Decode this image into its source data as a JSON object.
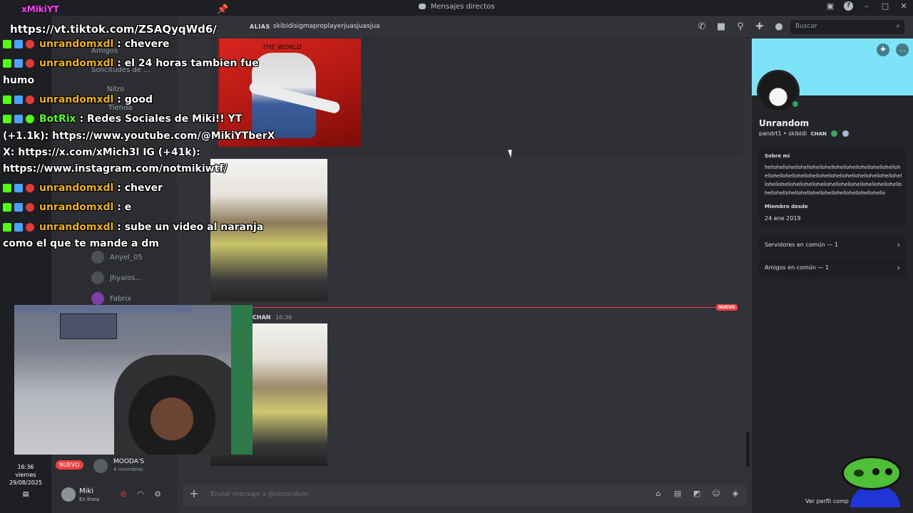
{
  "window": {
    "title": "Mensajes directos"
  },
  "header": {
    "alias_label": "ALIAS",
    "alias_value": "skibidisigmaproplayerjuasjuasjua",
    "search_placeholder": "Buscar"
  },
  "dm_list": {
    "items": [
      "Amigos",
      "Solicitudes de ...",
      "Nitro",
      "Tienda",
      "Anyel_05",
      "Jhyalos...",
      "Fabrix"
    ],
    "nuevo_label": "NUEVO",
    "group_name": "MOODA'S",
    "group_members": "4 miembros"
  },
  "chat": {
    "new_label": "NUEVO",
    "msg_tag": "CHAN",
    "msg_time": "16:36",
    "image1_caption": "THE WORLD",
    "composer_placeholder": "Enviar mensaje a @Unrandom"
  },
  "user_panel": {
    "name": "Miki",
    "status": "En línea"
  },
  "profile": {
    "name": "Unrandom",
    "handle": "pandrt1 • skibidi",
    "server_tag": "CHAN",
    "about_label": "Sobre mí",
    "bio": "hellohellohellohellohellohellohellohellohellohellohellohellohellohellohellohellohellohellohellohellohellohellohellohellohellohellohellohellohellohellohellohellohellohellohellohellohellohellohellohellohellohellohellohello",
    "member_since_label": "Miembro desde",
    "member_since": "24 ene 2019",
    "mutual_servers": "Servidores en común — 1",
    "mutual_friends": "Amigos en común — 1",
    "view_full": "Ver perfil comp"
  },
  "overlay": {
    "top_name": "xMikiYT",
    "link": "https://vt.tiktok.com/ZSAQyqWd6/",
    "messages": [
      {
        "user": "unrandomxdl",
        "text": " : chevere"
      },
      {
        "user": "unrandomxdl",
        "text": " : el 24 horas tambien fue"
      },
      {
        "user": "unrandomxdl",
        "text": " : good"
      },
      {
        "user": "BotRix",
        "text": " : Redes Sociales de Miki!! YT"
      },
      {
        "user": "unrandomxdl",
        "text": " : chever"
      },
      {
        "user": "unrandomxdl",
        "text": " : e"
      },
      {
        "user": "unrandomxdl",
        "text": " : sube un video al naranja"
      }
    ],
    "cont_humo": "humo",
    "cont_yt": "(+1.1k): https://www.youtube.com/@MikiYTberX",
    "cont_x": "X: https://x.com/xMich3l IG (+41k):",
    "cont_ig": "https://www.instagram.com/notmikiwtf/",
    "cont_dm": "como el que te mande a dm"
  },
  "clock": {
    "time": "16:36",
    "day": "viernes",
    "date": "29/08/2025"
  },
  "colors": {
    "accent_red": "#f23f43",
    "online_green": "#23a55a",
    "banner": "#7ce3f8",
    "chat_user": "#f0b400",
    "bot_user": "#53fc18"
  }
}
